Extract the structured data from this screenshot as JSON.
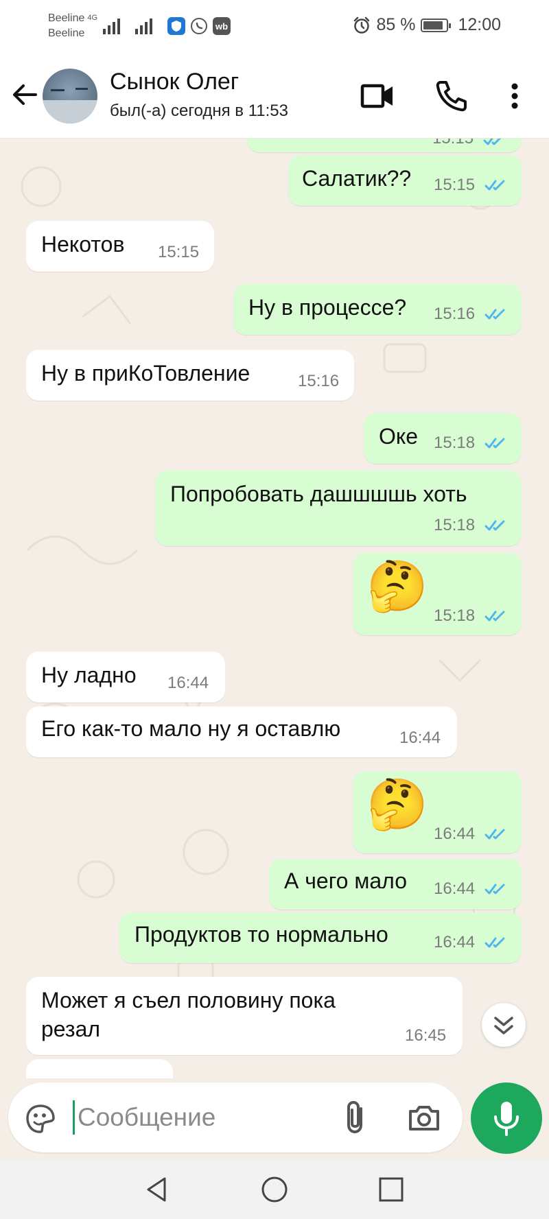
{
  "status_bar": {
    "carrier1": "Beeline",
    "carrier2": "Beeline",
    "network": "4G",
    "battery": "85 %",
    "battery_level": 0.85,
    "time": "12:00"
  },
  "header": {
    "name": "Сынок Олег",
    "last_seen": "был(-а) сегодня в 11:53"
  },
  "messages": [
    {
      "dir": "out",
      "text": "Салатик??",
      "time": "15:15",
      "read": true
    },
    {
      "dir": "in",
      "text": "Некотов",
      "time": "15:15"
    },
    {
      "dir": "out",
      "text": "Ну в процессе?",
      "time": "15:16",
      "read": true
    },
    {
      "dir": "in",
      "text": "Ну в приКоТовление",
      "time": "15:16"
    },
    {
      "dir": "out",
      "text": "Оке",
      "time": "15:18",
      "read": true
    },
    {
      "dir": "out",
      "text": "Попробовать дашшшшь хоть",
      "time": "15:18",
      "read": true
    },
    {
      "dir": "out",
      "text": "🤔",
      "time": "15:18",
      "read": true
    },
    {
      "dir": "in",
      "text": "Ну ладно",
      "time": "16:44"
    },
    {
      "dir": "in",
      "text": "Его как-то мало ну я оставлю",
      "time": "16:44"
    },
    {
      "dir": "out",
      "text": "🤔",
      "time": "16:44",
      "read": true
    },
    {
      "dir": "out",
      "text": "А чего мало",
      "time": "16:44",
      "read": true
    },
    {
      "dir": "out",
      "text": "Продуктов то нормально",
      "time": "16:44",
      "read": true
    },
    {
      "dir": "in",
      "text_line1": "Может я съел половину пока",
      "text_line2": "резал",
      "time": "16:45"
    }
  ],
  "partial_top_time": "15:15",
  "composer": {
    "placeholder": "Сообщение"
  },
  "icons": {
    "back": "arrow-left-icon",
    "video": "video-call-icon",
    "phone": "phone-icon",
    "menu": "more-vert-icon",
    "sticker": "sticker-icon",
    "attach": "paperclip-icon",
    "camera": "camera-icon",
    "mic": "microphone-icon",
    "scroll": "chevron-double-down-icon"
  },
  "colors": {
    "outgoing_bubble": "#d9fdd3",
    "incoming_bubble": "#ffffff",
    "accent_green": "#1da85d",
    "read_ticks": "#4fb6ec",
    "chat_background": "#f4eee6"
  }
}
